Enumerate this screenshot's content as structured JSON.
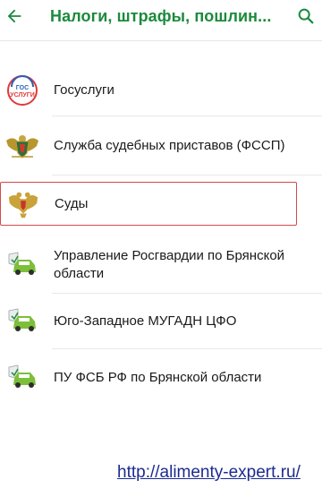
{
  "header": {
    "title": "Налоги, штрафы, пошлин...",
    "back_icon": "arrow-left-icon",
    "search_icon": "search-icon",
    "accent_color": "#1b8a3c"
  },
  "items": [
    {
      "label": "Госуслуги",
      "icon": "gosuslugi-logo"
    },
    {
      "label": "Служба судебных приставов (ФССП)",
      "icon": "fssp-emblem"
    },
    {
      "label": "Суды",
      "icon": "courts-emblem",
      "selected": true
    },
    {
      "label": "Управление Росгвардии по Брянской области",
      "icon": "car-shield-icon"
    },
    {
      "label": "Юго-Западное МУГАДН ЦФО",
      "icon": "car-shield-icon"
    },
    {
      "label": "ПУ ФСБ РФ по Брянской области",
      "icon": "car-shield-icon"
    }
  ],
  "watermark": "http://alimenty-expert.ru/",
  "selection_color": "#d14b4b"
}
